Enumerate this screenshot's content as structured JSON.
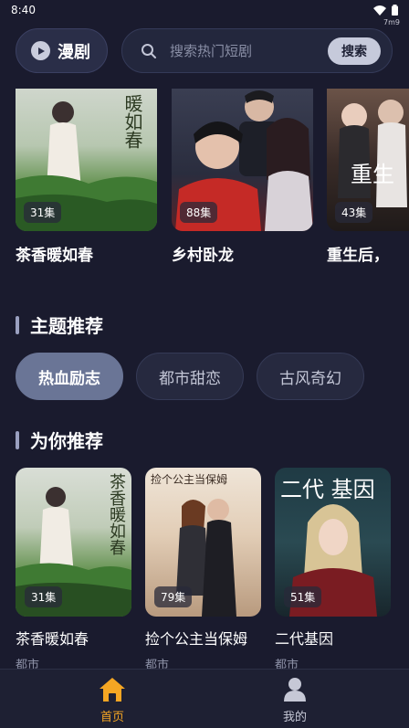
{
  "status_bar": {
    "time": "8:40",
    "network": "7m9"
  },
  "header": {
    "brand_label": "漫剧",
    "search_placeholder": "搜索热门短剧",
    "search_button": "搜索"
  },
  "carousel": [
    {
      "title": "茶香暖如春",
      "episodes": "31集",
      "poster_text": "暖如春"
    },
    {
      "title": "乡村卧龙",
      "episodes": "88集",
      "poster_text": ""
    },
    {
      "title": "重生后，",
      "episodes": "43集",
      "poster_text": "重生"
    }
  ],
  "themes": {
    "heading": "主题推荐",
    "chips": [
      "热血励志",
      "都市甜恋",
      "古风奇幻"
    ],
    "active_index": 0
  },
  "recommend": {
    "heading": "为你推荐",
    "items": [
      {
        "title": "茶香暖如春",
        "tag": "都市",
        "episodes": "31集",
        "poster_text": "茶香暖如春"
      },
      {
        "title": "捡个公主当保姆",
        "tag": "都市",
        "episodes": "79集",
        "poster_text": "捡个公主当保姆"
      },
      {
        "title": "二代基因",
        "tag": "都市",
        "episodes": "51集",
        "poster_text": "二代 基因"
      }
    ]
  },
  "bottom_nav": [
    {
      "label": "首页",
      "active": true,
      "icon": "home-icon"
    },
    {
      "label": "我的",
      "active": false,
      "icon": "user-icon"
    }
  ],
  "colors": {
    "background": "#1a1b2e",
    "accent": "#f5a623",
    "chip_active": "#6a7596"
  }
}
